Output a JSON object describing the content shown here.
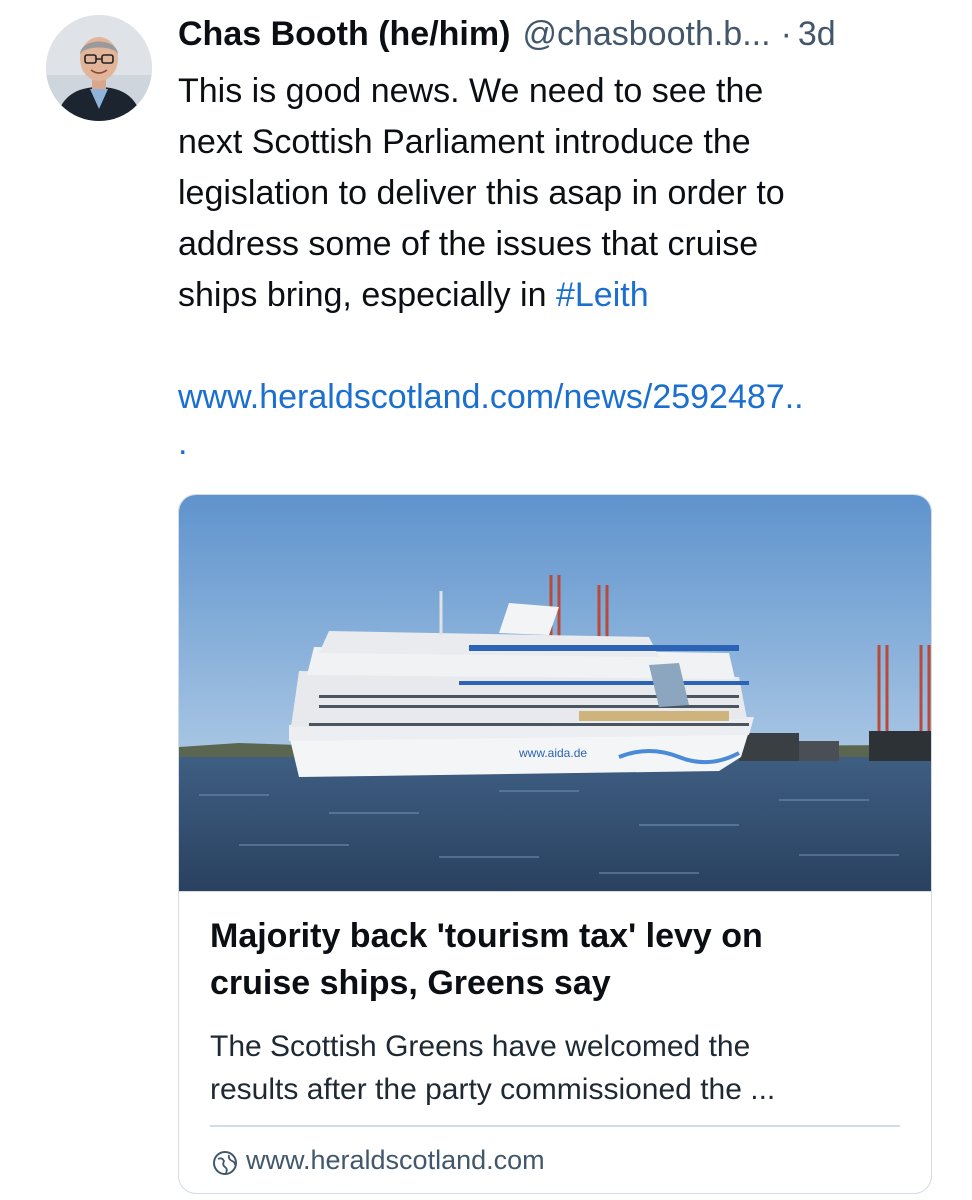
{
  "post": {
    "author": {
      "display_name": "Chas Booth (he/him)",
      "handle": "@chasbooth.b...",
      "avatar_icon": "user-avatar"
    },
    "separator": "·",
    "timestamp": "3d",
    "text": {
      "line_1": "This is good news. We need to see the",
      "line_2": "next Scottish Parliament introduce the",
      "line_3": "legislation to deliver this asap in order to",
      "line_4": "address some of the issues that cruise",
      "line_5_prefix": "ships bring, especially in ",
      "hashtag": "#Leith",
      "link": "www.heraldscotland.com/news/2592487..",
      "link_tail": "."
    },
    "link_card": {
      "image_icon": "cruise-ship-photo",
      "image_caption": "www.aida.de",
      "title_line_1": "Majority back 'tourism tax' levy on",
      "title_line_2": "cruise ships, Greens say",
      "description_line_1": "The Scottish Greens have welcomed the",
      "description_line_2": "results after the party commissioned the ...",
      "domain_icon": "globe-icon",
      "domain": "www.heraldscotland.com"
    }
  },
  "colors": {
    "link": "#1a6fcf",
    "muted": "#42576c",
    "border": "#d3dbe4",
    "text": "#0b0f14"
  }
}
